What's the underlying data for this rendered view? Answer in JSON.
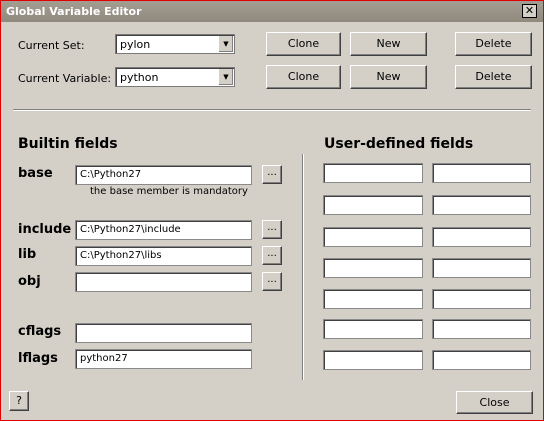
{
  "window": {
    "title": "Global Variable Editor",
    "close_glyph": "✕"
  },
  "set_row": {
    "label": "Current Set:",
    "value": "pylon",
    "clone": "Clone",
    "new": "New",
    "delete": "Delete"
  },
  "var_row": {
    "label": "Current Variable:",
    "value": "python",
    "clone": "Clone",
    "new": "New",
    "delete": "Delete"
  },
  "builtin": {
    "heading": "Builtin fields",
    "base": {
      "label": "base",
      "value": "C:\\Python27",
      "browse": "..."
    },
    "base_note": "the base member is mandatory",
    "include": {
      "label": "include",
      "value": "C:\\Python27\\include",
      "browse": "..."
    },
    "lib": {
      "label": "lib",
      "value": "C:\\Python27\\libs",
      "browse": "..."
    },
    "obj": {
      "label": "obj",
      "value": "",
      "browse": "..."
    },
    "cflags": {
      "label": "cflags",
      "value": ""
    },
    "lflags": {
      "label": "lflags",
      "value": "python27"
    }
  },
  "user": {
    "heading": "User-defined fields",
    "rows": [
      {
        "name": "",
        "value": ""
      },
      {
        "name": "",
        "value": ""
      },
      {
        "name": "",
        "value": ""
      },
      {
        "name": "",
        "value": ""
      },
      {
        "name": "",
        "value": ""
      },
      {
        "name": "",
        "value": ""
      },
      {
        "name": "",
        "value": ""
      }
    ]
  },
  "footer": {
    "help": "?",
    "close": "Close"
  },
  "colors": {
    "face": "#d4d0c8",
    "titlebar": "#98928a",
    "border": "#e00000"
  },
  "icons": {
    "dropdown": "chevron-down-icon"
  }
}
